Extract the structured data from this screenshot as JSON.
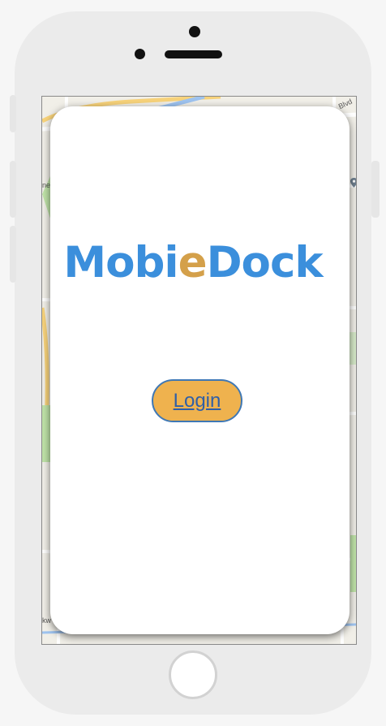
{
  "app": {
    "logo_part1": "Mobi",
    "logo_part2": "e",
    "logo_part3": "Dock",
    "login_label": "Login"
  },
  "map": {
    "label_top_right": "Blvd",
    "label_left": "ne",
    "label_bottom_left": "kw"
  },
  "colors": {
    "brand_blue": "#3b8fdc",
    "brand_orange": "#d4a04a",
    "button_fill": "#efb24e",
    "button_border": "#3f78b5",
    "button_text": "#2f5fa7"
  },
  "icons": {
    "map_pin": "map-pin-icon"
  }
}
